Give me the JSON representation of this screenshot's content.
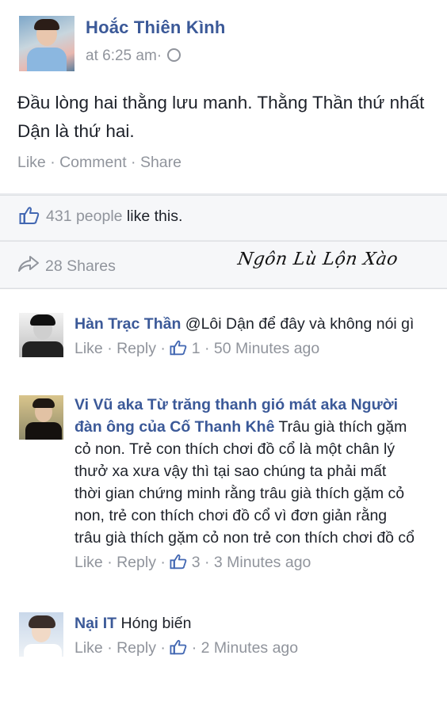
{
  "post": {
    "author": "Hoắc Thiên Kình",
    "time": "at 6:25 am·",
    "text": "Đầu lòng hai thằng lưu manh. Thằng Thần thứ nhất Dận là thứ hai.",
    "actions": "Like · Comment · Share"
  },
  "likes": {
    "count_text": "431 people",
    "suffix": " like this."
  },
  "shares": {
    "text": "28 Shares",
    "watermark": "Ngôn Lù Lộn Xào"
  },
  "comments": [
    {
      "name": "Hàn Trạc Thần",
      "text": " @Lôi Dận để đây và không nói gì",
      "actions_prefix": "Like · Reply · ",
      "actions_suffix": " 1 · 50 Minutes ago"
    },
    {
      "name": "Vi Vũ aka Từ trăng thanh gió mát aka Người đàn ông của Cố Thanh Khê",
      "text": " Trâu già thích gặm cỏ non. Trẻ con thích chơi đồ cổ là một chân lý thưở xa xưa vậy thì tại sao chúng ta phải mất thời gian chứng minh rằng trâu già thích gặm cỏ non, trẻ con thích chơi đồ cổ vì đơn giản rằng trâu già thích gặm cỏ non trẻ con thích chơi đồ cổ",
      "actions_prefix": "Like · Reply · ",
      "actions_suffix": " 3 · 3 Minutes ago"
    },
    {
      "name": "Nại IT",
      "text": " Hóng biến",
      "actions_prefix": "Like · Reply · ",
      "actions_suffix": " · 2 Minutes ago"
    }
  ]
}
